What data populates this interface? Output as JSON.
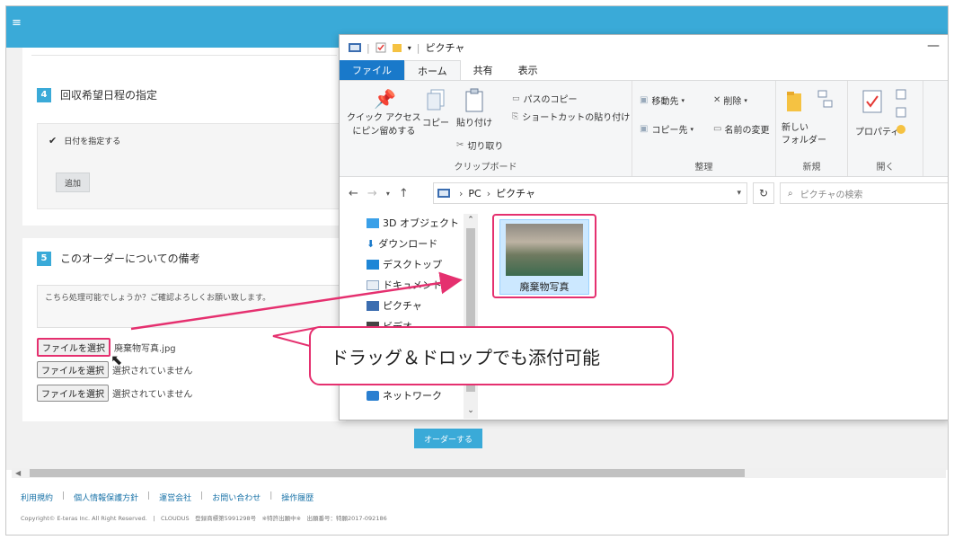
{
  "webapp": {
    "section4": {
      "number": "4",
      "title": "回収希望日程の指定",
      "option": "日付を指定する",
      "add_button": "追加"
    },
    "section5": {
      "number": "5",
      "title": "このオーダーについての備考",
      "note": "こちら処理可能でしょうか？ご確認よろしくお願い致します。",
      "files": [
        {
          "button": "ファイルを選択",
          "filename": "廃棄物写真.jpg"
        },
        {
          "button": "ファイルを選択",
          "filename": "選択されていません"
        },
        {
          "button": "ファイルを選択",
          "filename": "選択されていません"
        }
      ]
    },
    "order_button": "オーダーする",
    "footer_links": [
      "利用規約",
      "個人情報保護方針",
      "運営会社",
      "お問い合わせ",
      "操作履歴"
    ],
    "footer_sep": "|",
    "copyright": "Copyright© E-teras Inc. All Right Reserved.　|　CLOUDUS　登録商標第5991298号　※特許出願中※　出願番号：特願2017-092186"
  },
  "explorer": {
    "title": "ピクチャ",
    "tabs": [
      "ファイル",
      "ホーム",
      "共有",
      "表示"
    ],
    "clipboard": {
      "pin": "クイック アクセス\nにピン留めする",
      "copy": "コピー",
      "paste": "貼り付け",
      "copy_path": "パスのコピー",
      "paste_shortcut": "ショートカットの貼り付け",
      "cut": "切り取り",
      "label": "クリップボード"
    },
    "organize": {
      "move_to": "移動先",
      "delete": "削除",
      "copy_to": "コピー先",
      "rename": "名前の変更",
      "label": "整理"
    },
    "new": {
      "new_folder": "新しい\nフォルダー",
      "label": "新規"
    },
    "open": {
      "properties": "プロパティ",
      "label": "開く"
    },
    "address": {
      "pc": "PC",
      "folder": "ピクチャ"
    },
    "search_placeholder": "ピクチャの検索",
    "nav_items": [
      "3D オブジェクト",
      "ダウンロード",
      "デスクトップ",
      "ドキュメント",
      "ピクチャ",
      "ビデオ",
      "ネットワーク"
    ],
    "file_item": "廃棄物写真"
  },
  "callout": "ドラッグ＆ドロップでも添付可能",
  "colors": {
    "accent_blue": "#3aaad8",
    "highlight_pink": "#e5306f",
    "ribbon_file_tab": "#1979ca"
  }
}
